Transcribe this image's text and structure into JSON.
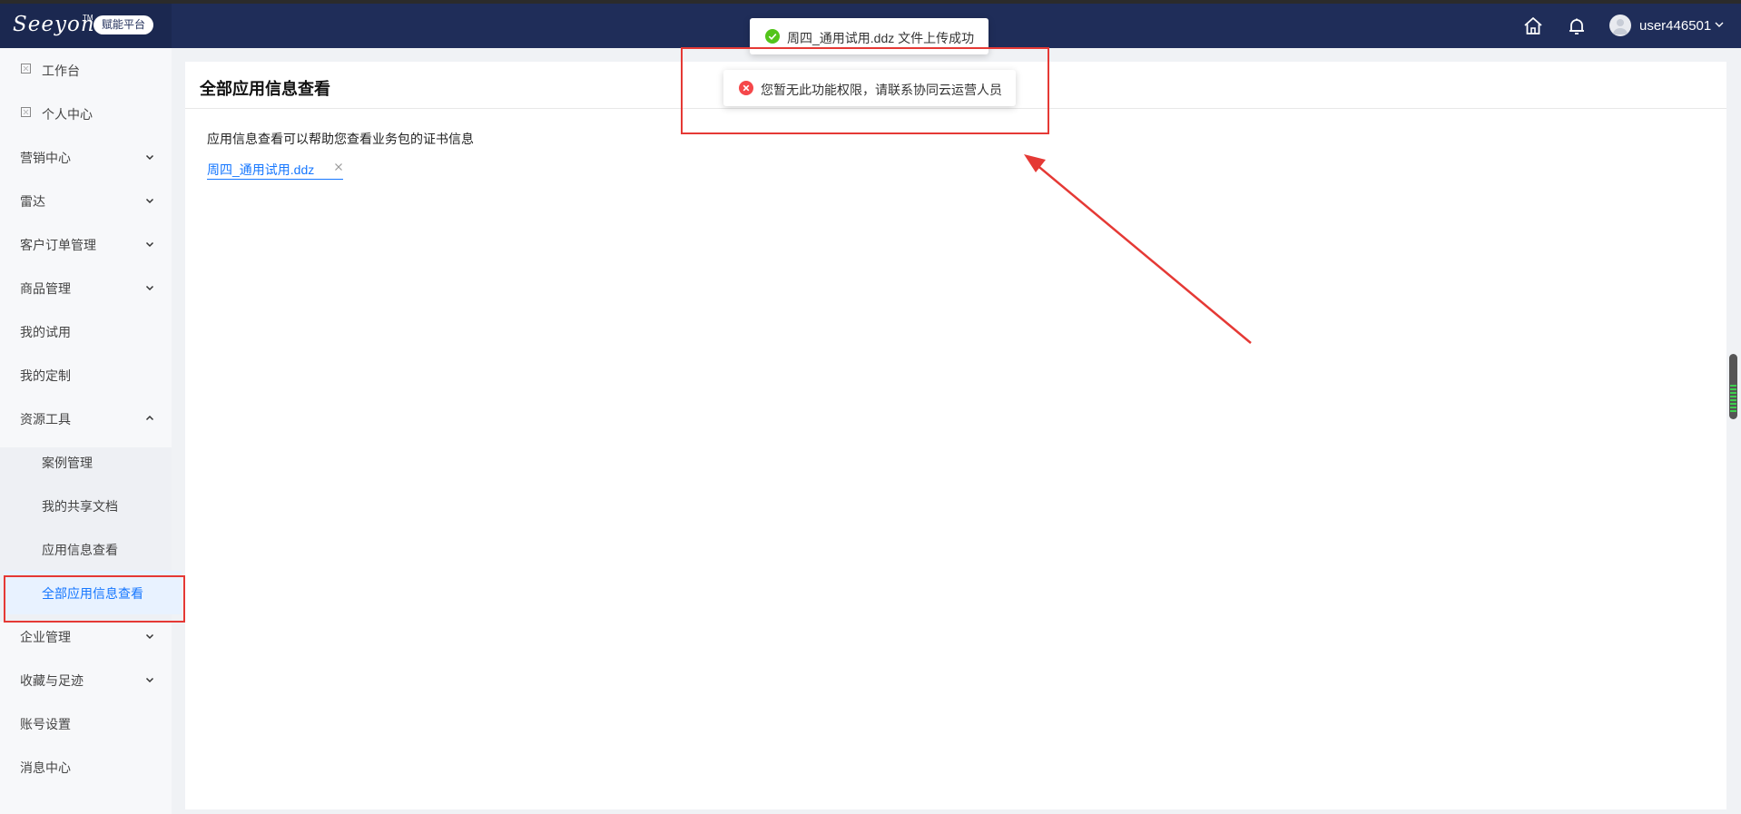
{
  "header": {
    "logo_text": "Seeyon",
    "logo_tm": "TM",
    "platform_badge": "赋能平台",
    "username": "user446501"
  },
  "sidebar": {
    "items": [
      {
        "label": "工作台",
        "has_box_icon": true
      },
      {
        "label": "个人中心",
        "has_box_icon": true
      },
      {
        "label": "营销中心",
        "chevron": "down"
      },
      {
        "label": "雷达",
        "chevron": "down"
      },
      {
        "label": "客户订单管理",
        "chevron": "down"
      },
      {
        "label": "商品管理",
        "chevron": "down"
      },
      {
        "label": "我的试用"
      },
      {
        "label": "我的定制"
      },
      {
        "label": "资源工具",
        "chevron": "up",
        "expanded": true
      },
      {
        "label": "案例管理",
        "sub": true
      },
      {
        "label": "我的共享文档",
        "sub": true
      },
      {
        "label": "应用信息查看",
        "sub": true
      },
      {
        "label": "全部应用信息查看",
        "sub": true,
        "active": true
      },
      {
        "label": "企业管理",
        "chevron": "down"
      },
      {
        "label": "收藏与足迹",
        "chevron": "down"
      },
      {
        "label": "账号设置"
      },
      {
        "label": "消息中心"
      }
    ]
  },
  "main": {
    "title": "全部应用信息查看",
    "description": "应用信息查看可以帮助您查看业务包的证书信息",
    "uploaded_file": "周四_通用试用.ddz"
  },
  "toasts": {
    "success": "周四_通用试用.ddz 文件上传成功",
    "error": "您暂无此功能权限，请联系协同云运营人员"
  },
  "colors": {
    "header_bg": "#1f2d59",
    "accent": "#1677ff",
    "success": "#52c41a",
    "error": "#f5474a",
    "annotation": "#e53935"
  }
}
